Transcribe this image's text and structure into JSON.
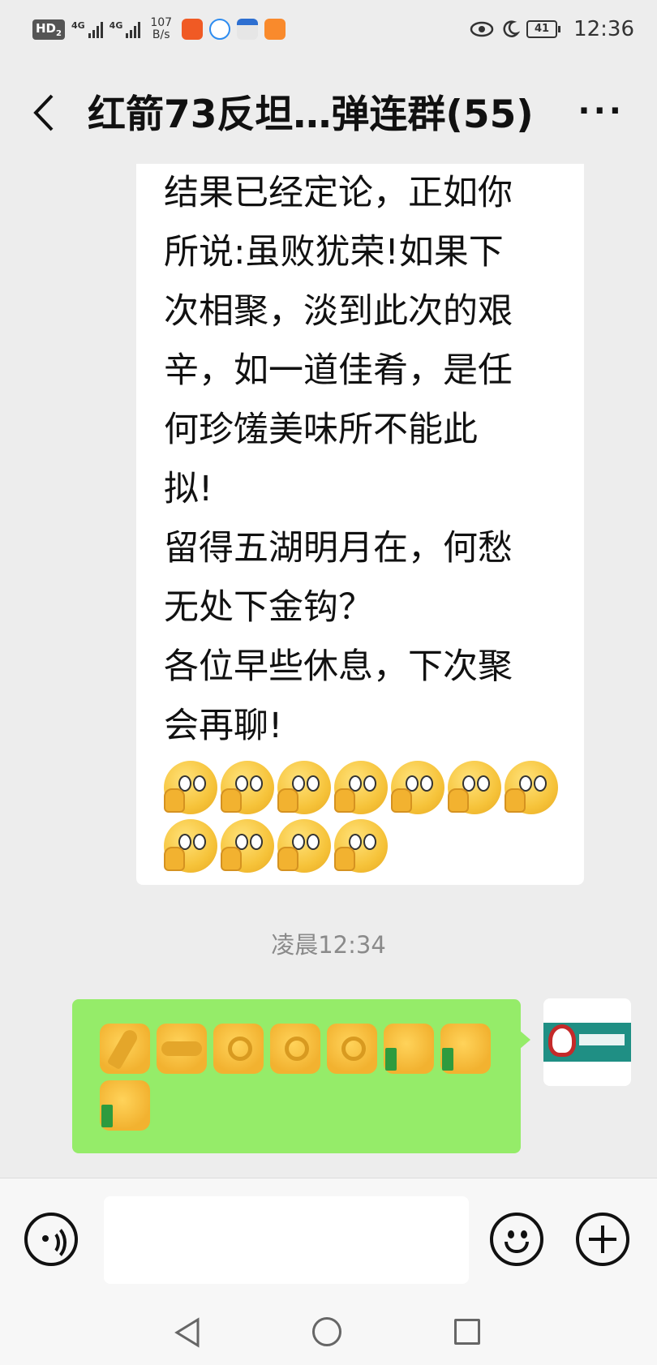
{
  "status_bar": {
    "hd_label": "HD",
    "sim_index": "2",
    "signal1_label": "4G",
    "signal2_label": "4G",
    "net_speed_value": "107",
    "net_speed_unit": "B/s",
    "battery_level": "41",
    "time": "12:36",
    "app_icons": [
      "app-icon-orange",
      "app-icon-blue",
      "app-icon-mail",
      "app-icon-play"
    ]
  },
  "header": {
    "title": "红箭73反坦…弹连群(55)",
    "back_icon": "chevron-left-icon",
    "more_label": "···"
  },
  "messages": {
    "incoming": {
      "text": "结果已经定论，正如你\n所说:虽败犹荣!如果下\n次相聚，淡到此次的艰\n辛，如一道佳肴，是任\n何珍馐美味所不能此\n拟!\n留得五湖明月在，何愁\n无处下金钩？\n各位早些休息，下次聚\n会再聊!",
      "emoji_count": 11,
      "emoji_name": "cover-face-smile-emoji"
    },
    "timestamp": "凌晨12:34",
    "outgoing": {
      "emojis": [
        "pray-emoji",
        "handshake-emoji",
        "ok-hand-emoji",
        "ok-hand-emoji",
        "ok-hand-emoji",
        "thumbs-up-emoji",
        "thumbs-up-emoji",
        "thumbs-up-emoji"
      ],
      "bubble_color": "#95ec69"
    }
  },
  "input_bar": {
    "placeholder": "",
    "voice_icon": "voice-icon",
    "emoji_icon": "smiley-icon",
    "plus_icon": "plus-icon"
  },
  "nav_bar": {
    "icons": [
      "triangle-back-icon",
      "circle-home-icon",
      "square-recent-icon"
    ]
  }
}
